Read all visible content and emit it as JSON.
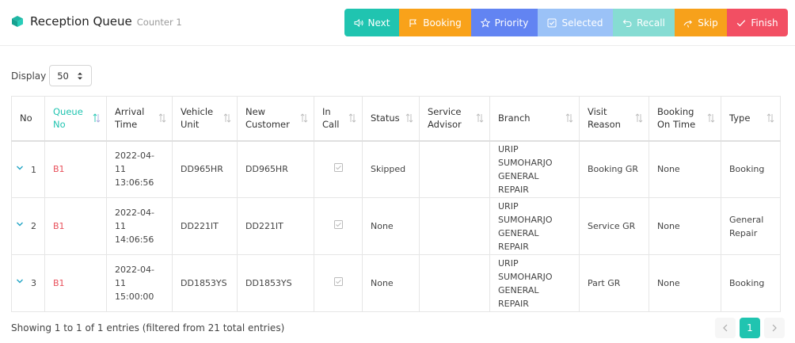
{
  "header": {
    "title": "Reception Queue",
    "subtitle": "Counter 1",
    "icon": "box-icon",
    "accent_color": "#20c4b0"
  },
  "toolbar": {
    "next": "Next",
    "booking": "Booking",
    "priority": "Priority",
    "selected": "Selected",
    "recall": "Recall",
    "skip": "Skip",
    "finish": "Finish"
  },
  "display": {
    "label": "Display",
    "value": "50"
  },
  "table": {
    "headers": {
      "no": "No",
      "queue_no": "Queue No",
      "arrival_time": "Arrival Time",
      "vehicle_unit": "Vehicle Unit",
      "new_customer": "New Customer",
      "in_call": "In Call",
      "status": "Status",
      "service_advisor": "Service Advisor",
      "branch": "Branch",
      "visit_reason": "Visit Reason",
      "booking_on_time": "Booking On Time",
      "type": "Type"
    },
    "rows": [
      {
        "no": "1",
        "queue_no": "B1",
        "arrival_date": "2022-04-11",
        "arrival_clock": "13:06:56",
        "vehicle_unit": "DD965HR",
        "new_customer": "DD965HR",
        "status": "Skipped",
        "service_advisor": "",
        "branch_l1": "URIP",
        "branch_l2": "SUMOHARJO",
        "branch_l3": "GENERAL REPAIR",
        "visit_reason": "Booking GR",
        "booking_on_time": "None",
        "type": "Booking"
      },
      {
        "no": "2",
        "queue_no": "B1",
        "arrival_date": "2022-04-11",
        "arrival_clock": "14:06:56",
        "vehicle_unit": "DD221IT",
        "new_customer": "DD221IT",
        "status": "None",
        "service_advisor": "",
        "branch_l1": "URIP",
        "branch_l2": "SUMOHARJO",
        "branch_l3": "GENERAL REPAIR",
        "visit_reason": "Service GR",
        "booking_on_time": "None",
        "type": "General Repair"
      },
      {
        "no": "3",
        "queue_no": "B1",
        "arrival_date": "2022-04-11",
        "arrival_clock": "15:00:00",
        "vehicle_unit": "DD1853YS",
        "new_customer": "DD1853YS",
        "status": "None",
        "service_advisor": "",
        "branch_l1": "URIP",
        "branch_l2": "SUMOHARJO",
        "branch_l3": "GENERAL REPAIR",
        "visit_reason": "Part GR",
        "booking_on_time": "None",
        "type": "Booking"
      }
    ]
  },
  "footer": {
    "info": "Showing 1 to 1 of 1 entries (filtered from 21 total entries)",
    "current_page": "1"
  }
}
